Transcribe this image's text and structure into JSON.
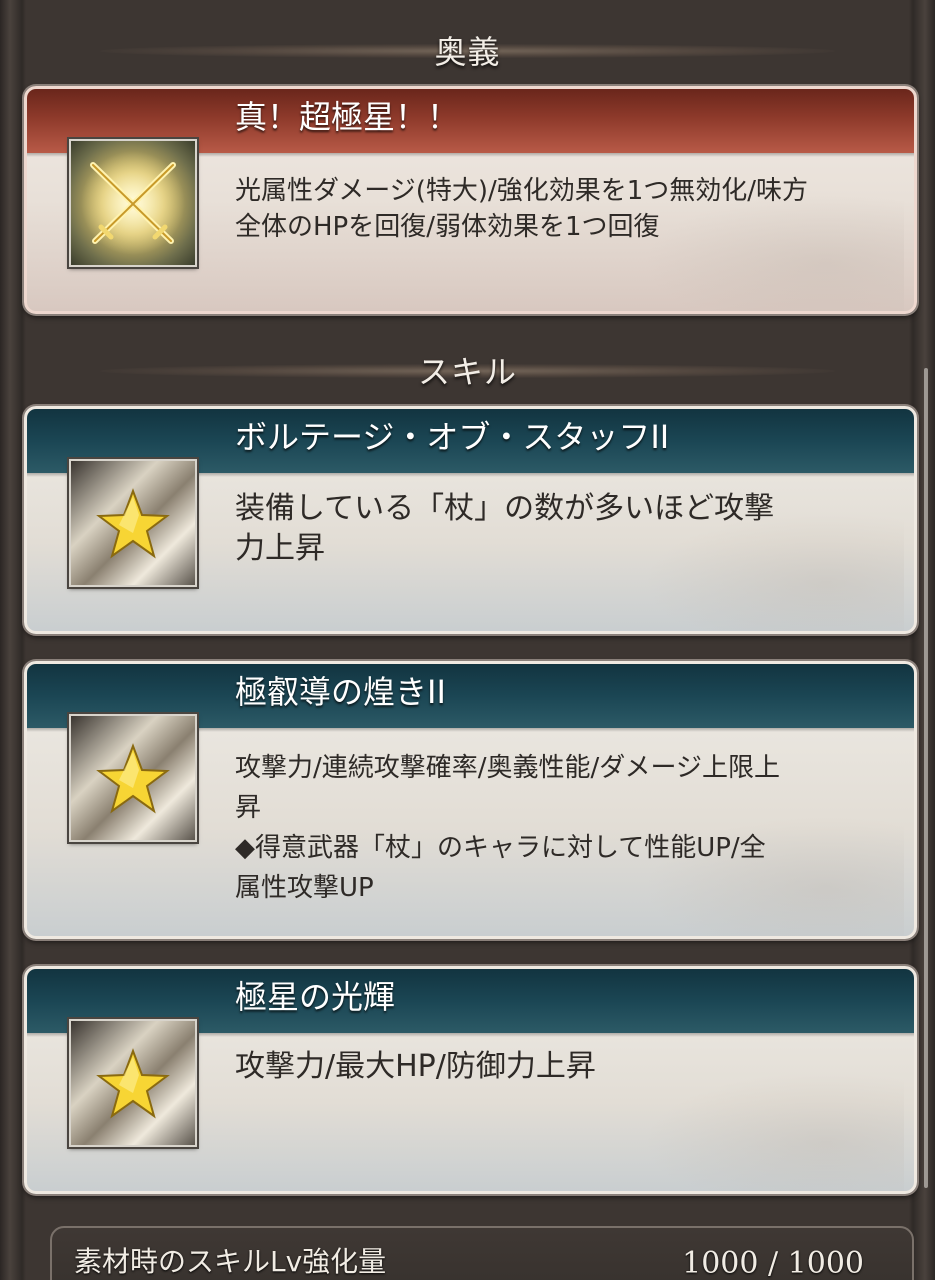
{
  "ougi": {
    "section_label": "奥義",
    "title": "真！超極星！！",
    "description": "光属性ダメージ(特大)/強化効果を1つ無効化/味方\n全体のHPを回復/弱体効果を1つ回復",
    "icon": "crossed-swords-icon"
  },
  "skills": {
    "section_label": "スキル",
    "items": [
      {
        "title": "ボルテージ・オブ・スタッフII",
        "description": "装備している「杖」の数が多いほど攻撃\n力上昇",
        "icon": "star-icon"
      },
      {
        "title": "極叡導の煌きII",
        "description": "攻撃力/連続攻撃確率/奥義性能/ダメージ上限上\n昇\n◆得意武器「杖」のキャラに対して性能UP/全\n属性攻撃UP",
        "icon": "star-icon"
      },
      {
        "title": "極星の光輝",
        "description": "攻撃力/最大HP/防御力上昇",
        "icon": "star-icon"
      }
    ]
  },
  "footer": {
    "label": "素材時のスキルLv強化量",
    "value": "1000 / 1000"
  },
  "colors": {
    "ougi_header": "#8e3a2b",
    "skill_header": "#1b4654"
  }
}
